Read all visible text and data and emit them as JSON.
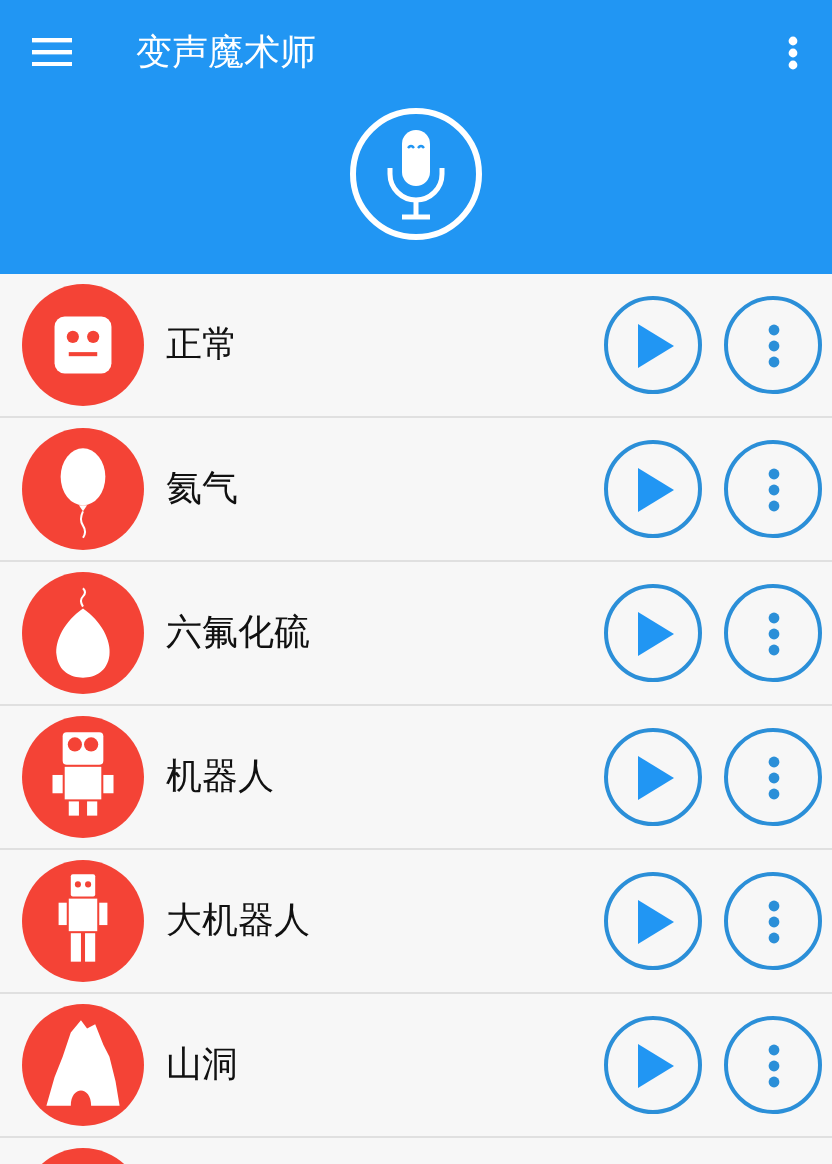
{
  "app_bar": {
    "title": "变声魔术师"
  },
  "effects": [
    {
      "kind": "face",
      "label": "正常"
    },
    {
      "kind": "balloon",
      "label": "氦气"
    },
    {
      "kind": "heavy-balloon",
      "label": "六氟化硫"
    },
    {
      "kind": "robot",
      "label": "机器人"
    },
    {
      "kind": "tall-robot",
      "label": "大机器人"
    },
    {
      "kind": "cave",
      "label": "山洞"
    },
    {
      "kind": "partial"
    }
  ]
}
